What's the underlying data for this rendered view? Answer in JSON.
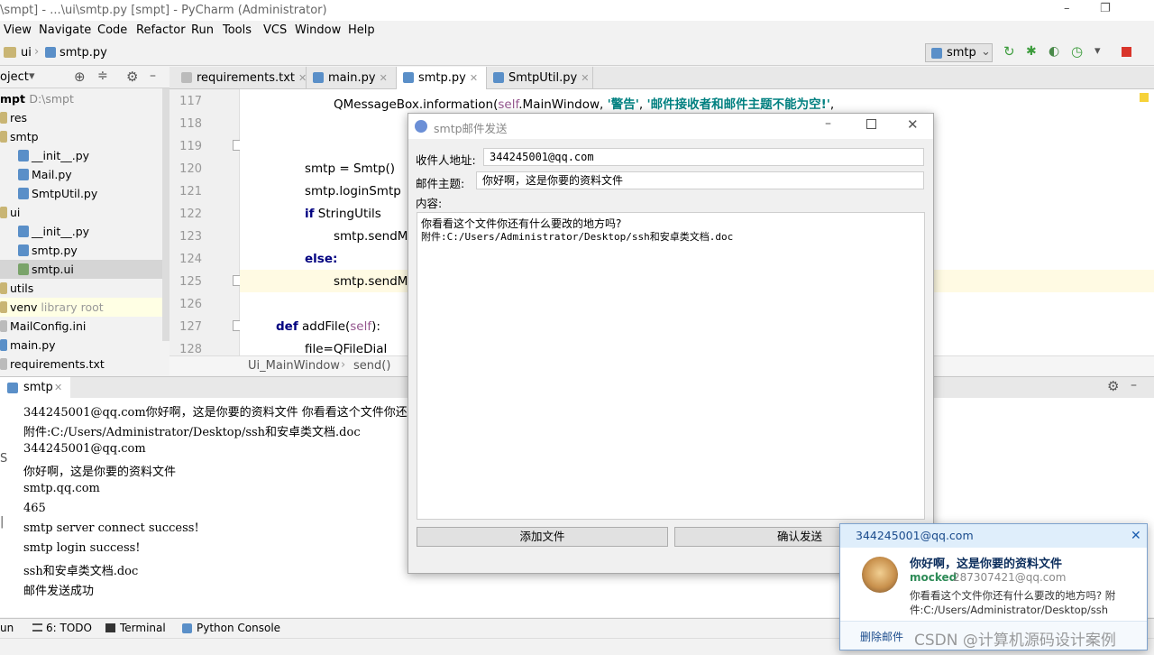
{
  "window": {
    "title": "\\smpt] - ...\\ui\\smtp.py [smpt] - PyCharm (Administrator)",
    "minimize": "–",
    "restore": "❐"
  },
  "menu": [
    "View",
    "Navigate",
    "Code",
    "Refactor",
    "Run",
    "Tools",
    "VCS",
    "Window",
    "Help"
  ],
  "nav": {
    "crumb1": "ui",
    "crumb2": "smtp.py",
    "run_config": "smtp"
  },
  "project": {
    "header": "oject",
    "items": [
      {
        "label": "mpt",
        "extra": "D:\\smpt"
      },
      {
        "label": "res",
        "extra": ""
      },
      {
        "label": "smtp",
        "extra": ""
      },
      {
        "label": "__init__.py",
        "extra": ""
      },
      {
        "label": "Mail.py",
        "extra": ""
      },
      {
        "label": "SmtpUtil.py",
        "extra": ""
      },
      {
        "label": "ui",
        "extra": ""
      },
      {
        "label": "__init__.py",
        "extra": ""
      },
      {
        "label": "smtp.py",
        "extra": ""
      },
      {
        "label": "smtp.ui",
        "extra": ""
      },
      {
        "label": "utils",
        "extra": ""
      },
      {
        "label": "venv",
        "extra": "library root"
      },
      {
        "label": "MailConfig.ini",
        "extra": ""
      },
      {
        "label": "main.py",
        "extra": ""
      },
      {
        "label": "requirements.txt",
        "extra": ""
      }
    ]
  },
  "tabs": [
    {
      "label": "requirements.txt"
    },
    {
      "label": "main.py"
    },
    {
      "label": "smtp.py"
    },
    {
      "label": "SmtpUtil.py"
    }
  ],
  "editor": {
    "line_numbers": [
      "117",
      "118",
      "119",
      "120",
      "121",
      "122",
      "123",
      "124",
      "125",
      "126",
      "127",
      "128"
    ],
    "l117_a": "QMessageBox.information(",
    "l117_self": "self",
    "l117_b": ".MainWindow, ",
    "l117_s1": "'警告'",
    "l117_c": ", ",
    "l117_s2": "'邮件接收者和邮件主题不能为空!'",
    "l117_d": ",",
    "l120": "smtp = Smtp()",
    "l121": "smtp.loginSmtp",
    "l122_kw": "if",
    "l122": " StringUtils",
    "l123": "smtp.sendMa",
    "l124_kw": "else:",
    "l125": "smtp.sendMa",
    "l127_kw": "def",
    "l127": " addFile(",
    "l127_self": "self",
    "l127_end": "):",
    "l128": "file=QFileDial"
  },
  "breadcrumb": {
    "a": "Ui_MainWindow",
    "b": "send()"
  },
  "run": {
    "tab": "smtp",
    "lines": [
      "344245001@qq.com你好啊，这是你要的资料文件 你看看这个文件你还",
      "附件:C:/Users/Administrator/Desktop/ssh和安卓类文档.doc",
      "344245001@qq.com",
      "你好啊，这是你要的资料文件",
      "smtp.qq.com",
      "465",
      "smtp server connect success!",
      "smtp login success!",
      "ssh和安卓类文档.doc",
      "邮件发送成功"
    ]
  },
  "bottom": {
    "run": "un",
    "todo": "6: TODO",
    "terminal": "Terminal",
    "console": "Python Console"
  },
  "dialog": {
    "title": "smtp邮件发送",
    "recipient_label": "收件人地址:",
    "recipient_value": "344245001@qq.com",
    "subject_label": "邮件主题:",
    "subject_value": "你好啊，这是你要的资料文件",
    "content_label": "内容:",
    "content_line1": "你看看这个文件你还有什么要改的地方吗?",
    "content_line2": "附件:C:/Users/Administrator/Desktop/ssh和安卓类文档.doc",
    "add_file": "添加文件",
    "send": "确认发送"
  },
  "toast": {
    "to": "344245001@qq.com",
    "subject": "你好啊，这是你要的资料文件",
    "sender_name": "mocked",
    "sender_email": "287307421@qq.com",
    "body1": "你看看这个文件你还有什么要改的地方吗? 附",
    "body2": "件:C:/Users/Administrator/Desktop/ssh",
    "delete": "删除邮件"
  },
  "watermark": "CSDN @计算机源码设计案例",
  "colors": {
    "accent": "#7da2ce",
    "keyword": "#000080",
    "string": "#008080",
    "self": "#94558d",
    "sender": "#2e8b57"
  }
}
